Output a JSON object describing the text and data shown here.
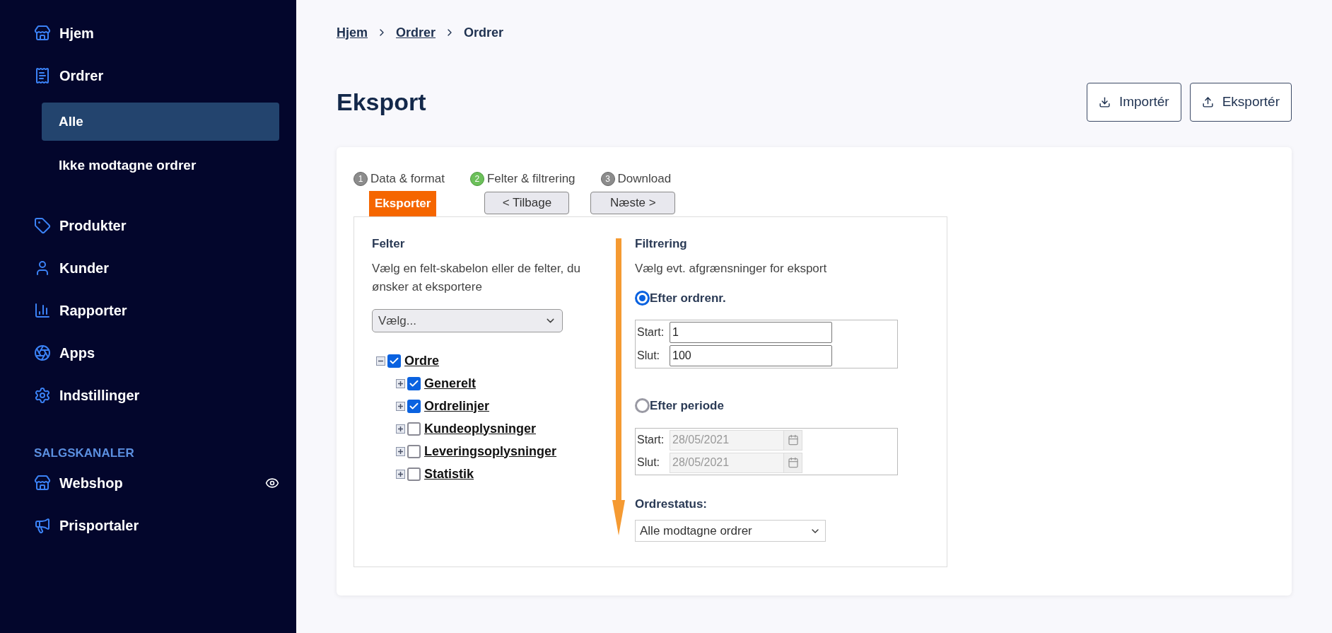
{
  "sidebar": {
    "sections": [
      {
        "items": [
          {
            "label": "Hjem",
            "selected": false
          },
          {
            "label": "Ordrer",
            "selected": false,
            "children": [
              {
                "label": "Alle",
                "selected": true
              },
              {
                "label": "Ikke modtagne ordrer",
                "selected": false
              }
            ]
          },
          {
            "label": "Produkter",
            "selected": false
          },
          {
            "label": "Kunder",
            "selected": false
          },
          {
            "label": "Rapporter",
            "selected": false
          },
          {
            "label": "Apps",
            "selected": false
          },
          {
            "label": "Indstillinger",
            "selected": false
          }
        ]
      },
      {
        "title": "SALGSKANALER",
        "items": [
          {
            "label": "Webshop",
            "selected": false,
            "visible": true
          },
          {
            "label": "Prisportaler",
            "selected": false
          }
        ]
      }
    ]
  },
  "breadcrumb": [
    {
      "label": "Hjem",
      "link": true
    },
    {
      "label": "Ordrer",
      "link": true
    },
    {
      "label": "Ordrer",
      "link": false
    }
  ],
  "page_title": "Eksport",
  "actions": [
    {
      "label": "Importér",
      "kind": "import"
    },
    {
      "label": "Eksportér",
      "kind": "export"
    }
  ],
  "wizard": {
    "steps": [
      {
        "number": "1",
        "label": "Data & format",
        "selected": false
      },
      {
        "number": "2",
        "label": "Felter & filtrering",
        "selected": true
      },
      {
        "number": "3",
        "label": "Download",
        "selected": false
      }
    ],
    "tab": "Eksporter",
    "back": "< Tilbage",
    "next": "Næste >",
    "fields": {
      "heading": "Felter",
      "description": "Vælg en felt-skabelon eller de felter, du ønsker at eksportere",
      "template_select": "Vælg...",
      "tree": [
        {
          "label": "Ordre",
          "checked": true,
          "expanded": true,
          "children": [
            {
              "label": "Generelt",
              "checked": true,
              "expanded": false
            },
            {
              "label": "Ordrelinjer",
              "checked": true,
              "expanded": false
            },
            {
              "label": "Kundeoplysninger",
              "checked": false,
              "expanded": false
            },
            {
              "label": "Leveringsoplysninger",
              "checked": false,
              "expanded": false
            },
            {
              "label": "Statistik",
              "checked": false,
              "expanded": false
            }
          ]
        }
      ]
    },
    "filter": {
      "heading": "Filtrering",
      "description": "Vælg evt. afgrænsninger for eksport",
      "options": [
        {
          "label": "Efter ordrenr.",
          "selected": true,
          "kind": "number",
          "fields": [
            {
              "label": "Start:",
              "value": "1"
            },
            {
              "label": "Slut:",
              "value": "100"
            }
          ]
        },
        {
          "label": "Efter periode",
          "selected": false,
          "kind": "date",
          "fields": [
            {
              "label": "Start:",
              "value": "28/05/2021"
            },
            {
              "label": "Slut:",
              "value": "28/05/2021"
            }
          ]
        }
      ],
      "status_label": "Ordrestatus:",
      "status_value": "Alle modtagne ordrer"
    }
  }
}
